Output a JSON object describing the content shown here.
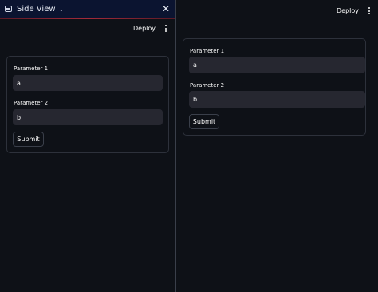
{
  "side_view": {
    "title": "Side View",
    "chevron": "⌄",
    "close": "✕",
    "icon": "side-view-icon"
  },
  "left_toolbar": {
    "deploy_label": "Deploy"
  },
  "right_toolbar": {
    "deploy_label": "Deploy"
  },
  "left_form": {
    "param1_label": "Parameter 1",
    "param1_value": "a",
    "param2_label": "Parameter 2",
    "param2_value": "b",
    "submit_label": "Submit"
  },
  "right_form": {
    "param1_label": "Parameter 1",
    "param1_value": "a",
    "param2_label": "Parameter 2",
    "param2_value": "b",
    "submit_label": "Submit"
  },
  "colors": {
    "background": "#0e1117",
    "header": "#0b1430",
    "accent_bar": "#a32a3a",
    "input_bg": "#262730",
    "border": "#2d313b"
  }
}
